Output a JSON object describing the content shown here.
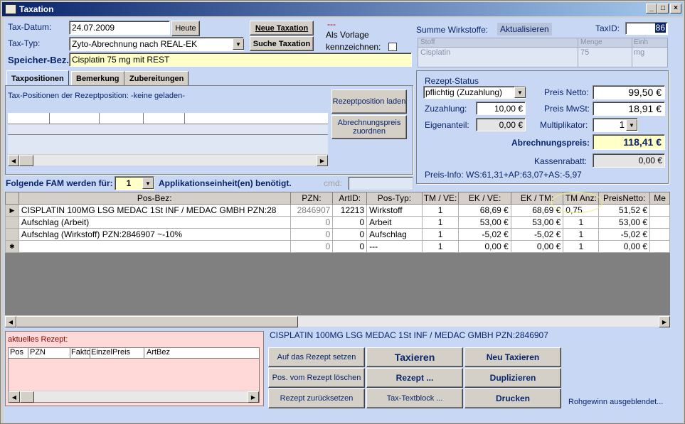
{
  "window": {
    "title": "Taxation"
  },
  "header": {
    "tax_datum_label": "Tax-Datum:",
    "tax_datum_value": "24.07.2009",
    "heute_label": "Heute",
    "tax_typ_label": "Tax-Typ:",
    "tax_typ_value": "Zyto-Abrechnung nach REAL-EK",
    "speicher_label": "Speicher-Bez.:",
    "speicher_value": "Cisplatin 75 mg mit REST",
    "neue_taxation": "Neue Taxation",
    "suche_taxation": "Suche Taxation",
    "dashes": "---",
    "als_vorlage": "Als Vorlage",
    "kennzeichnen": "kennzeichnen:"
  },
  "wirkstoffe": {
    "summe_label": "Summe Wirkstoffe:",
    "aktualisieren": "Aktualisieren",
    "taxid_label": "TaxID:",
    "taxid_value": "86",
    "columns": [
      "Stoff",
      "Menge",
      "Einh"
    ],
    "rows": [
      {
        "stoff": "Cisplatin",
        "menge": "75",
        "einh": "mg"
      }
    ]
  },
  "tabs": [
    {
      "label": "Taxpositionen"
    },
    {
      "label": "Bemerkung"
    },
    {
      "label": "Zubereitungen"
    }
  ],
  "taxpos": {
    "info": "Tax-Positionen der Rezeptposition:  -keine geladen-",
    "rezeptposition_laden": "Rezeptposition laden",
    "abrechnungspreis_zuordnen": "Abrechnungspreis zuordnen"
  },
  "rezept": {
    "status_label": "Rezept-Status",
    "status_value": "pflichtig (Zuzahlung)",
    "zuzahlung_label": "Zuzahlung:",
    "zuzahlung_value": "10,00 €",
    "eigenanteil_label": "Eigenanteil:",
    "eigenanteil_value": "0,00 €",
    "preis_netto_label": "Preis Netto:",
    "preis_netto_value": "99,50 €",
    "preis_mwst_label": "Preis MwSt:",
    "preis_mwst_value": "18,91 €",
    "multiplikator_label": "Multiplikator:",
    "multiplikator_value": "1",
    "abrechnungspreis_label": "Abrechnungspreis:",
    "abrechnungspreis_value": "118,41 €",
    "kassenrabatt_label": "Kassenrabatt:",
    "kassenrabatt_value": "0,00 €",
    "preis_info": "Preis-Info: WS:61,31+AP:63,07+AS:-5,97"
  },
  "fam": {
    "label": "Folgende FAM werden für:",
    "value": "1",
    "suffix": "Applikationseinheit(en) benötigt.",
    "cmd_label": "cmd:"
  },
  "grid": {
    "columns": [
      "Pos-Bez:",
      "PZN:",
      "ArtID:",
      "Pos-Typ:",
      "TM / VE:",
      "EK / VE:",
      "EK / TM:",
      "TM Anz:",
      "PreisNetto:",
      "Me"
    ],
    "rows": [
      {
        "marker": "▶",
        "bez": "CISPLATIN 100MG LSG MEDAC   1St INF  / MEDAC GMBH PZN:28",
        "pzn": "2846907",
        "artid": "12213",
        "typ": "Wirkstoff",
        "tmve": "1",
        "ekve": "68,69 €",
        "ektm": "68,69 €",
        "tmanz": "0,75",
        "netto": "51,52 €"
      },
      {
        "marker": "",
        "bez": "Aufschlag (Arbeit)",
        "pzn": "0",
        "artid": "0",
        "typ": "Arbeit",
        "tmve": "1",
        "ekve": "53,00 €",
        "ektm": "53,00 €",
        "tmanz": "1",
        "netto": "53,00 €"
      },
      {
        "marker": "",
        "bez": "Aufschlag (Wirkstoff) PZN:2846907 ~-10%",
        "pzn": "0",
        "artid": "0",
        "typ": "Aufschlag",
        "tmve": "1",
        "ekve": "-5,02 €",
        "ektm": "-5,02 €",
        "tmanz": "1",
        "netto": "-5,02 €"
      },
      {
        "marker": "✱",
        "bez": "",
        "pzn": "0",
        "artid": "0",
        "typ": "---",
        "tmve": "1",
        "ekve": "0,00 €",
        "ektm": "0,00 €",
        "tmanz": "1",
        "netto": "0,00 €"
      }
    ]
  },
  "aktuelles_rezept": {
    "label": "aktuelles Rezept:",
    "columns": [
      "Pos",
      "PZN",
      "Fakto",
      "EinzelPreis",
      "ArtBez"
    ]
  },
  "footer": {
    "product_line": "CISPLATIN 100MG LSG MEDAC   1St INF  / MEDAC GMBH PZN:2846907",
    "auf_rezept": "Auf das Rezept setzen",
    "pos_loeschen": "Pos. vom Rezept löschen",
    "rezept_zurueck": "Rezept zurücksetzen",
    "taxieren": "Taxieren",
    "rezept": "Rezept ...",
    "textblock": "Tax-Textblock ...",
    "neu_taxieren": "Neu Taxieren",
    "duplizieren": "Duplizieren",
    "drucken": "Drucken",
    "rohgewinn": "Rohgewinn ausgeblendet..."
  }
}
